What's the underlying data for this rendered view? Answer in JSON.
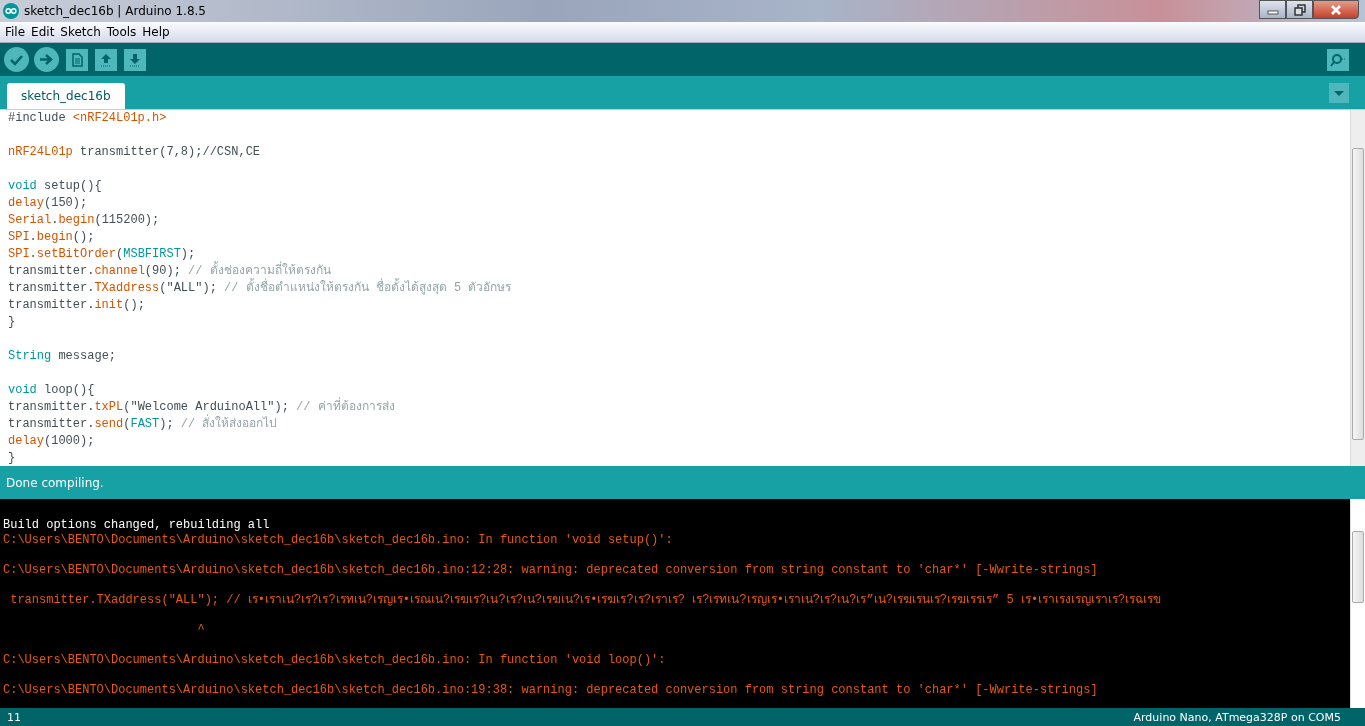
{
  "window": {
    "title": "sketch_dec16b | Arduino 1.8.5"
  },
  "menu": [
    "File",
    "Edit",
    "Sketch",
    "Tools",
    "Help"
  ],
  "toolbar": {
    "buttons": [
      {
        "kind": "verify"
      },
      {
        "kind": "upload"
      },
      {
        "kind": "new"
      },
      {
        "kind": "open"
      },
      {
        "kind": "save"
      }
    ],
    "right": {
      "kind": "monitor"
    }
  },
  "tabs": [
    {
      "label": "sketch_dec16b",
      "selected": true
    }
  ],
  "editor": {
    "lines": [
      {
        "tokens": [
          {
            "text": "#include ",
            "kind": "plain"
          },
          {
            "text": "<nRF24L01p.h>",
            "kind": "func"
          }
        ]
      },
      {
        "after_blank": true,
        "tokens": [
          {
            "text": "nRF24L01p",
            "kind": "func"
          },
          {
            "text": " transmitter(7,8);//CSN,CE",
            "kind": "plain"
          }
        ]
      },
      {
        "after_blank": true,
        "tokens": [
          {
            "text": "void",
            "kind": "type"
          },
          {
            "text": " setup(){",
            "kind": "plain"
          }
        ]
      },
      {
        "tokens": [
          {
            "text": "delay",
            "kind": "func"
          },
          {
            "text": "(150);",
            "kind": "plain"
          }
        ]
      },
      {
        "tokens": [
          {
            "text": "Serial",
            "kind": "func"
          },
          {
            "text": ".",
            "kind": "plain"
          },
          {
            "text": "begin",
            "kind": "func"
          },
          {
            "text": "(115200);",
            "kind": "plain"
          }
        ]
      },
      {
        "tokens": [
          {
            "text": "SPI",
            "kind": "func"
          },
          {
            "text": ".",
            "kind": "plain"
          },
          {
            "text": "begin",
            "kind": "func"
          },
          {
            "text": "();",
            "kind": "plain"
          }
        ]
      },
      {
        "tokens": [
          {
            "text": "SPI",
            "kind": "func"
          },
          {
            "text": ".",
            "kind": "plain"
          },
          {
            "text": "setBitOrder",
            "kind": "func"
          },
          {
            "text": "(",
            "kind": "plain"
          },
          {
            "text": "MSBFIRST",
            "kind": "type"
          },
          {
            "text": ");",
            "kind": "plain"
          }
        ]
      },
      {
        "tokens": [
          {
            "text": "transmitter.",
            "kind": "plain"
          },
          {
            "text": "channel",
            "kind": "func"
          },
          {
            "text": "(90); ",
            "kind": "plain"
          },
          {
            "text": "// ตั้งช่องความถี่ให้ตรงกัน",
            "kind": "comment"
          }
        ]
      },
      {
        "tokens": [
          {
            "text": "transmitter.",
            "kind": "plain"
          },
          {
            "text": "TXaddress",
            "kind": "func"
          },
          {
            "text": "(\"ALL\"); ",
            "kind": "plain"
          },
          {
            "text": "// ตั้งชื่อตำแหน่งให้ตรงกัน ชื่อตั้งได้สูงสุด 5 ตัวอักษร",
            "kind": "comment"
          }
        ]
      },
      {
        "tokens": [
          {
            "text": "transmitter.",
            "kind": "plain"
          },
          {
            "text": "init",
            "kind": "func"
          },
          {
            "text": "();",
            "kind": "plain"
          }
        ]
      },
      {
        "tokens": [
          {
            "text": "}",
            "kind": "plain"
          }
        ]
      },
      {
        "after_blank": true,
        "tokens": [
          {
            "text": "String",
            "kind": "type"
          },
          {
            "text": " message;",
            "kind": "plain"
          }
        ]
      },
      {
        "after_blank": true,
        "tokens": [
          {
            "text": "void",
            "kind": "type"
          },
          {
            "text": " loop(){",
            "kind": "plain"
          }
        ]
      },
      {
        "tokens": [
          {
            "text": "transmitter.",
            "kind": "plain"
          },
          {
            "text": "txPL",
            "kind": "func"
          },
          {
            "text": "(\"Welcome ArduinoAll\"); ",
            "kind": "plain"
          },
          {
            "text": "// ค่าที่ต้องการส่ง",
            "kind": "comment"
          }
        ]
      },
      {
        "tokens": [
          {
            "text": "transmitter.",
            "kind": "plain"
          },
          {
            "text": "send",
            "kind": "func"
          },
          {
            "text": "(",
            "kind": "plain"
          },
          {
            "text": "FAST",
            "kind": "type"
          },
          {
            "text": "); ",
            "kind": "plain"
          },
          {
            "text": "// สั่งให้ส่งออกไป",
            "kind": "comment"
          }
        ]
      },
      {
        "tokens": [
          {
            "text": "delay",
            "kind": "func"
          },
          {
            "text": "(1000);",
            "kind": "plain"
          }
        ]
      },
      {
        "tokens": [
          {
            "text": "}",
            "kind": "plain"
          }
        ]
      }
    ]
  },
  "status": "Done compiling.",
  "console": {
    "lines": [
      {
        "after_blank": true,
        "kind": "info",
        "text": "Build options changed, rebuilding all"
      },
      {
        "kind": "error",
        "text": "C:\\Users\\BENTO\\Documents\\Arduino\\sketch_dec16b\\sketch_dec16b.ino: In function 'void setup()':"
      },
      {
        "after_blank": true,
        "kind": "error",
        "text": "C:\\Users\\BENTO\\Documents\\Arduino\\sketch_dec16b\\sketch_dec16b.ino:12:28: warning: deprecated conversion from string constant to 'char*' [-Wwrite-strings]"
      },
      {
        "after_blank": true,
        "kind": "error",
        "text": " transmitter.TXaddress(\"ALL\"); // เร•เราเน?เร?เร?เรทเน?เรญเร•เรณเน?เรฆเร?เน?เร?เน?เรฆเน?เร•เรฆเร?เร?เราเร? เร?เรทเน?เรญเร•เราเน?เร?เน?เร”เน?เรฆเรนเร?เรฆเรรเร” 5 เร•เราเรงเรญเราเร?เรฉเรข"
      },
      {
        "after_blank": true,
        "kind": "error",
        "text": "                           ^"
      },
      {
        "after_blank": true,
        "kind": "error",
        "text": "C:\\Users\\BENTO\\Documents\\Arduino\\sketch_dec16b\\sketch_dec16b.ino: In function 'void loop()':"
      },
      {
        "after_blank": true,
        "kind": "error",
        "text": "C:\\Users\\BENTO\\Documents\\Arduino\\sketch_dec16b\\sketch_dec16b.ino:19:38: warning: deprecated conversion from string constant to 'char*' [-Wwrite-strings]"
      }
    ]
  },
  "footer": {
    "line": "11",
    "board": "Arduino Nano, ATmega328P on COM5"
  }
}
